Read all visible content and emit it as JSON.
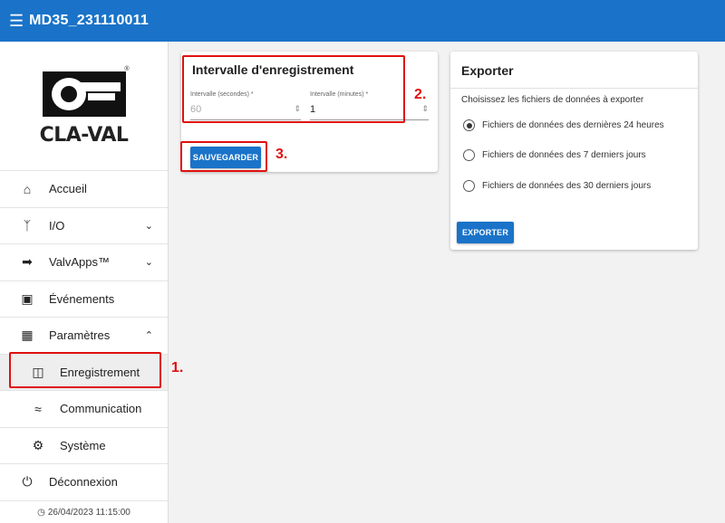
{
  "header": {
    "menu_icon": "menu-icon",
    "title": "MD35_231110011"
  },
  "sidebar": {
    "logo_text": "CLA-VAL",
    "items": [
      {
        "label": "Accueil",
        "icon": "home-icon"
      },
      {
        "label": "I/O",
        "icon": "io-icon",
        "expandable": true,
        "expanded": false
      },
      {
        "label": "ValvApps™",
        "icon": "valvapps-icon",
        "expandable": true,
        "expanded": false
      },
      {
        "label": "Événements",
        "icon": "calendar-icon"
      },
      {
        "label": "Paramètres",
        "icon": "settings-icon",
        "expandable": true,
        "expanded": true
      },
      {
        "label": "Enregistrement",
        "icon": "document-icon",
        "sub": true,
        "active": true
      },
      {
        "label": "Communication",
        "icon": "wifi-icon",
        "sub": true
      },
      {
        "label": "Système",
        "icon": "gear-icon",
        "sub": true
      },
      {
        "label": "Déconnexion",
        "icon": "power-icon"
      }
    ],
    "footer_date": "26/04/2023 11:15:00"
  },
  "interval_card": {
    "title": "Intervalle d'enregistrement",
    "seconds_label": "Intervalle (secondes) *",
    "seconds_value": "60",
    "minutes_label": "Intervalle (minutes) *",
    "minutes_value": "1",
    "save_label": "SAUVEGARDER"
  },
  "export_card": {
    "title": "Exporter",
    "description": "Choisissez les fichiers de données à exporter",
    "options": [
      "Fichiers de données des dernières 24 heures",
      "Fichiers de données des 7 derniers jours",
      "Fichiers de données des 30 derniers jours"
    ],
    "selected_index": 0,
    "export_label": "EXPORTER"
  },
  "callouts": [
    "1.",
    "2.",
    "3."
  ],
  "colors": {
    "primary": "#1a73c8",
    "callout": "#e01010"
  }
}
